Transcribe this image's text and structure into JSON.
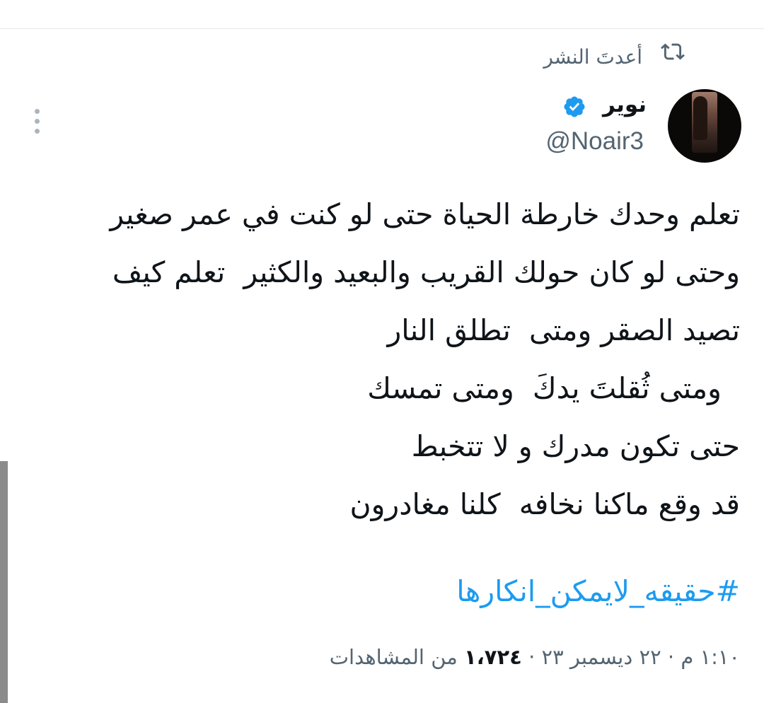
{
  "retweet": {
    "label": "أعدتَ النشر",
    "icon": "retweet-icon"
  },
  "author": {
    "display_name": "نوير",
    "handle": "@Noair3",
    "verified": true,
    "verified_color": "#1d9bf0"
  },
  "tweet": {
    "lines": [
      "تعلم وحدك خارطة الحياة حتى لو كنت في عمر صغير",
      "وحتى لو كان حولك القريب والبعيد والكثير  تعلم كيف",
      "تصيد الصقر ومتى  تطلق النار",
      "  ومتى ثُقلتَ يدكَ  ومتى تمسك",
      "حتى تكون مدرك و لا تتخبط",
      "قد وقع ماكنا نخافه  كلنا مغادرون"
    ],
    "hashtag": "#حقيقه_لايمكن_انكارها",
    "hashtag_color": "#1d9bf0"
  },
  "meta": {
    "time": "١:١٠ م",
    "separator": "·",
    "date": "٢٢ ديسمبر ٢٣",
    "views_count": "١،٧٢٤",
    "views_label": "من المشاهدات"
  },
  "icons": {
    "more": "more-vertical-icon",
    "verified": "verified-badge-icon",
    "avatar": "avatar"
  }
}
